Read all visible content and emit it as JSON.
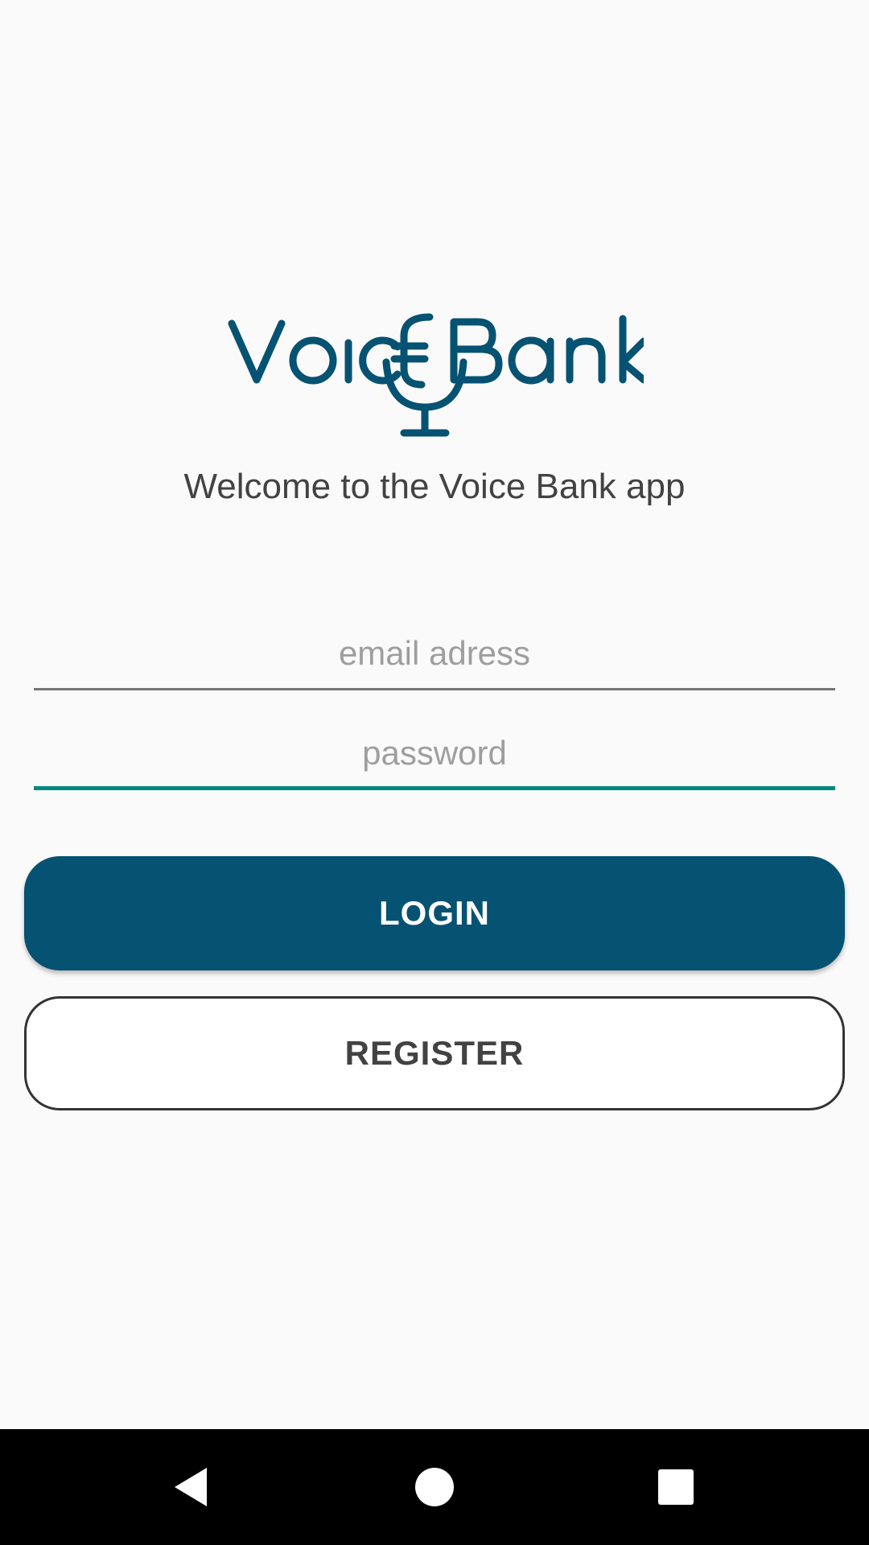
{
  "brand": {
    "logo_text": "VoiceBank",
    "color": "#065272"
  },
  "welcome_text": "Welcome to the Voice Bank app",
  "form": {
    "email": {
      "placeholder": "email adress",
      "value": ""
    },
    "password": {
      "placeholder": "password",
      "value": ""
    }
  },
  "buttons": {
    "login": "LOGIN",
    "register": "REGISTER"
  },
  "colors": {
    "primary": "#065272",
    "focus_accent": "#00897b",
    "background": "#fafafa"
  },
  "navbar": {
    "back_icon": "back-triangle-icon",
    "home_icon": "home-circle-icon",
    "recents_icon": "recents-square-icon"
  }
}
